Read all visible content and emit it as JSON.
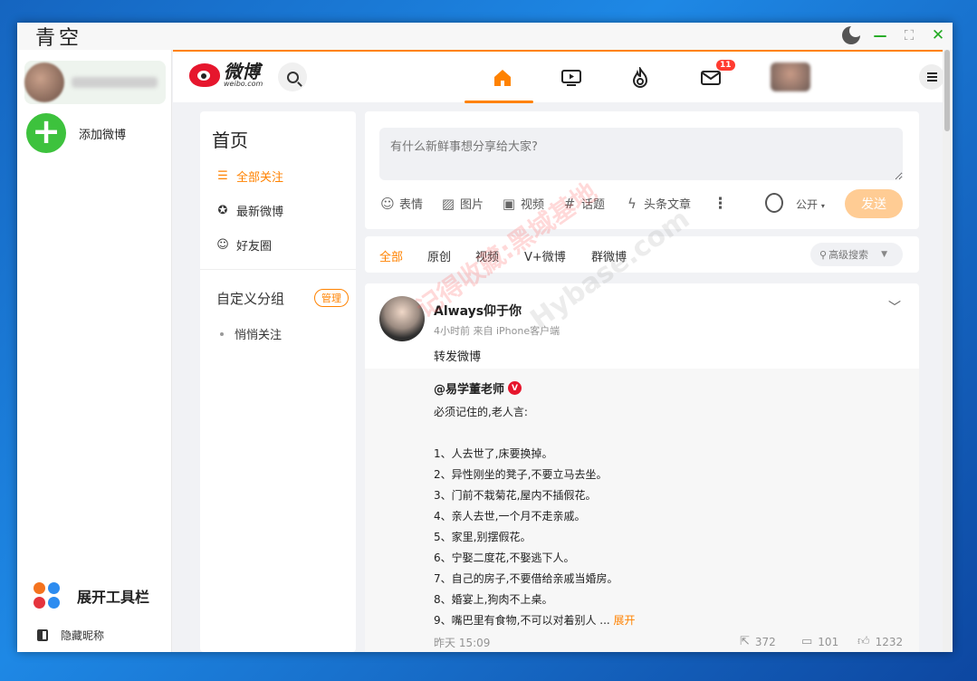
{
  "window": {
    "title": "青空"
  },
  "accounts": {
    "add_label": "添加微博",
    "toolbar_label": "展开工具栏",
    "hide_nickname_label": "隐藏昵称",
    "tool_colors": [
      "#f4731f",
      "#2d8cf0",
      "#e5343d",
      "#2d8cf0"
    ]
  },
  "weibo": {
    "logo_cn": "微博",
    "logo_en": "weibo.com",
    "message_badge": "11",
    "nav": [
      "home-icon",
      "video-icon",
      "hot-icon",
      "mail-icon"
    ]
  },
  "sidenav": {
    "title": "首页",
    "items": [
      {
        "label": "全部关注",
        "icon": "list-icon",
        "active": true
      },
      {
        "label": "最新微博",
        "icon": "star-icon",
        "active": false
      },
      {
        "label": "好友圈",
        "icon": "friends-icon",
        "active": false
      }
    ],
    "group_title": "自定义分组",
    "group_manage": "管理",
    "group_items": [
      "悄悄关注"
    ]
  },
  "composer": {
    "placeholder": "有什么新鲜事想分享给大家?",
    "tools": [
      "表情",
      "图片",
      "视频",
      "话题",
      "头条文章"
    ],
    "visibility": "公开",
    "send_label": "发送"
  },
  "filters": {
    "tabs": [
      "全部",
      "原创",
      "视频",
      "V+微博",
      "群微博"
    ],
    "active": "全部",
    "advanced_search": "高级搜索"
  },
  "post": {
    "author": "Always仰于你",
    "meta": "4小时前 来自 iPhone客户端",
    "text": "转发微博",
    "repost": {
      "author": "@易学董老师",
      "badge": "V",
      "lines": [
        "必须记住的,老人言:",
        "",
        "1、人去世了,床要换掉。",
        "2、异性刚坐的凳子,不要立马去坐。",
        "3、门前不栽菊花,屋内不插假花。",
        "4、亲人去世,一个月不走亲戚。",
        "5、家里,别摆假花。",
        "6、宁娶二度花,不娶逃下人。",
        "7、自己的房子,不要借给亲戚当婚房。",
        "8、婚宴上,狗肉不上桌。"
      ],
      "last_line": "9、嘴巴里有食物,不可以对着别人 ...",
      "expand": "展开"
    },
    "footer": {
      "date": "昨天 15:09",
      "shares": "372",
      "comments": "101",
      "likes": "1232"
    }
  },
  "watermarks": [
    "记得收藏:黑域基地",
    "Hybase.com"
  ]
}
